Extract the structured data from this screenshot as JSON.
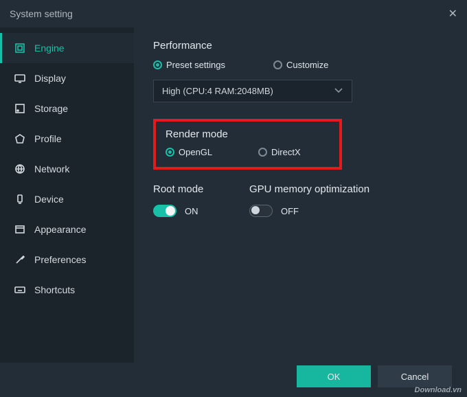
{
  "titlebar": {
    "title": "System setting"
  },
  "sidebar": {
    "items": [
      {
        "label": "Engine"
      },
      {
        "label": "Display"
      },
      {
        "label": "Storage"
      },
      {
        "label": "Profile"
      },
      {
        "label": "Network"
      },
      {
        "label": "Device"
      },
      {
        "label": "Appearance"
      },
      {
        "label": "Preferences"
      },
      {
        "label": "Shortcuts"
      }
    ]
  },
  "content": {
    "performance": {
      "title": "Performance",
      "preset_label": "Preset settings",
      "customize_label": "Customize",
      "select_value": "High (CPU:4 RAM:2048MB)"
    },
    "render": {
      "title": "Render mode",
      "opengl_label": "OpenGL",
      "directx_label": "DirectX"
    },
    "root": {
      "title": "Root mode",
      "state_label": "ON"
    },
    "gpu": {
      "title": "GPU memory optimization",
      "state_label": "OFF"
    }
  },
  "footer": {
    "ok_label": "OK",
    "cancel_label": "Cancel"
  },
  "watermark": "Download.vn"
}
